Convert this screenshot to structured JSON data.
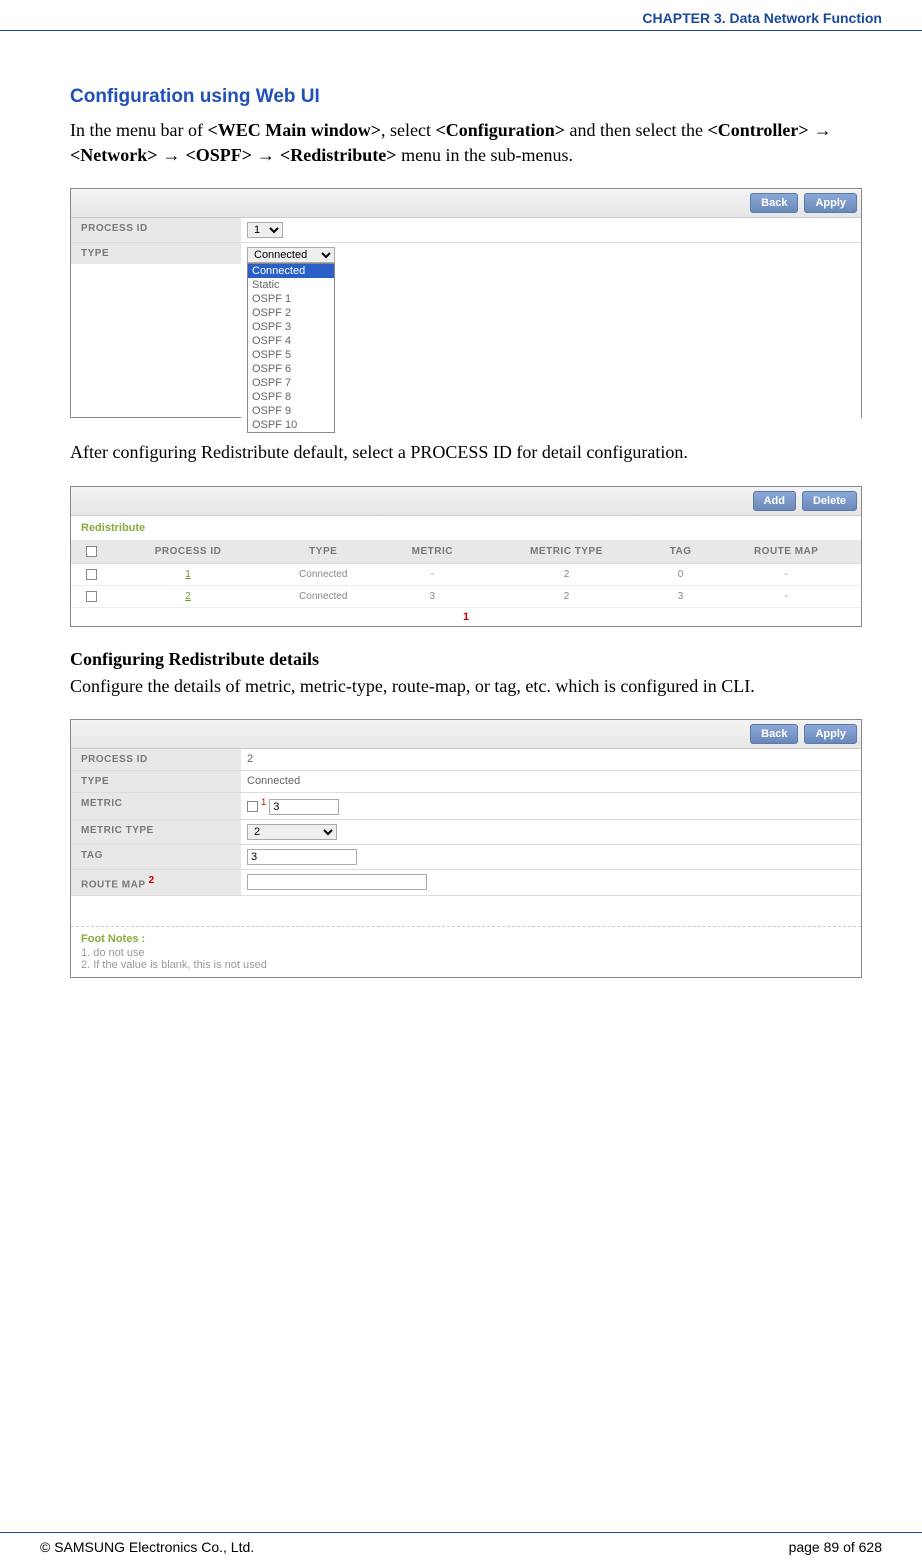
{
  "header": {
    "chapter": "CHAPTER 3. Data Network Function"
  },
  "section": {
    "title": "Configuration using Web UI",
    "para1_a": "In the menu bar of ",
    "para1_b": "<WEC Main window>",
    "para1_c": ", select ",
    "para1_d": "<Configuration>",
    "para1_e": " and then select the ",
    "para1_f": "<Controller>",
    "arrow": " → ",
    "para1_g": "<Network>",
    "para1_h": "<OSPF>",
    "para1_i": "<Redistribute>",
    "para1_j": " menu in the sub-menus."
  },
  "screenshot1": {
    "btn_back": "Back",
    "btn_apply": "Apply",
    "label_process_id": "PROCESS ID",
    "process_id_value": "1",
    "label_type": "TYPE",
    "type_selected": "Connected",
    "type_options": [
      "Connected",
      "Static",
      "OSPF 1",
      "OSPF 2",
      "OSPF 3",
      "OSPF 4",
      "OSPF 5",
      "OSPF 6",
      "OSPF 7",
      "OSPF 8",
      "OSPF 9",
      "OSPF 10"
    ]
  },
  "para2": "After configuring Redistribute default, select a PROCESS ID for detail configuration.",
  "screenshot2": {
    "btn_add": "Add",
    "btn_delete": "Delete",
    "subtitle": "Redistribute",
    "headers": [
      "",
      "PROCESS ID",
      "TYPE",
      "METRIC",
      "METRIC TYPE",
      "TAG",
      "ROUTE MAP"
    ],
    "rows": [
      {
        "pid": "1",
        "type": "Connected",
        "metric": "-",
        "metric_type": "2",
        "tag": "0",
        "route_map": "-"
      },
      {
        "pid": "2",
        "type": "Connected",
        "metric": "3",
        "metric_type": "2",
        "tag": "3",
        "route_map": "-"
      }
    ],
    "page": "1"
  },
  "sub_heading": "Configuring Redistribute details",
  "para3": "Configure the details of metric, metric-type, route-map, or tag, etc. which is configured in CLI.",
  "screenshot3": {
    "btn_back": "Back",
    "btn_apply": "Apply",
    "label_process_id": "PROCESS ID",
    "process_id_value": "2",
    "label_type": "TYPE",
    "type_value": "Connected",
    "label_metric": "METRIC",
    "metric_note": "1",
    "metric_value": "3",
    "label_metric_type": "METRIC TYPE",
    "metric_type_value": "2",
    "label_tag": "TAG",
    "tag_value": "3",
    "label_route_map": "ROUTE MAP",
    "route_map_note": "2",
    "route_map_value": "",
    "footnotes_title": "Foot Notes :",
    "footnote1": "1. do not use",
    "footnote2": "2. If the value is blank, this is not used"
  },
  "footer": {
    "copyright": "© SAMSUNG Electronics Co., Ltd.",
    "page": "page 89 of 628"
  }
}
